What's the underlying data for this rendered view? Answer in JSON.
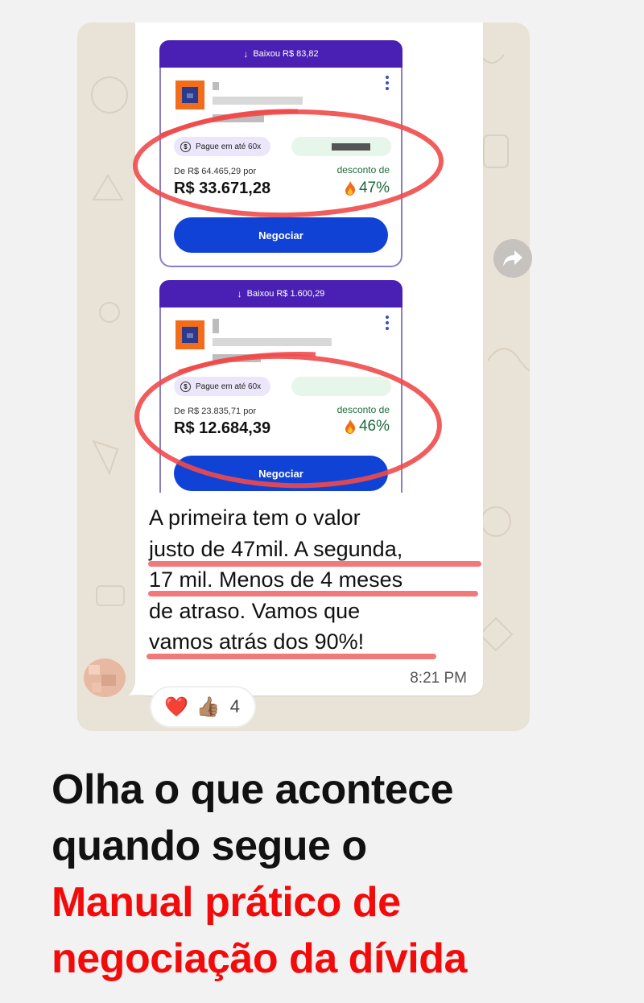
{
  "cards": [
    {
      "banner": "Baixou R$ 83,82",
      "pill": "Pague em até 60x",
      "old_price": "De R$ 64.465,29 por",
      "new_price": "R$ 33.671,28",
      "discount_label": "desconto de",
      "discount_value": "47%",
      "button": "Negociar"
    },
    {
      "banner": "Baixou R$ 1.600,29",
      "pill": "Pague em até 60x",
      "old_price": "De R$ 23.835,71 por",
      "new_price": "R$ 12.684,39",
      "discount_label": "desconto de",
      "discount_value": "46%",
      "button": "Negociar"
    }
  ],
  "message": {
    "lines": [
      "A primeira tem o valor",
      "justo de 47mil. A segunda,",
      "17 mil. Menos de 4 meses",
      "de atraso. Vamos que",
      "vamos atrás dos 90%!"
    ],
    "time": "8:21 PM"
  },
  "reactions": {
    "emojis": [
      "❤️",
      "👍🏽"
    ],
    "count": "4"
  },
  "headline": {
    "line1": "Olha o que acontece",
    "line2": "quando segue o",
    "line3": "Manual prático de",
    "line4": "negociação da dívida"
  },
  "colors": {
    "banner": "#4a20b4",
    "button": "#1142d6",
    "highlight_red": "#f20b0b",
    "discount_green": "#1e6b3c"
  }
}
